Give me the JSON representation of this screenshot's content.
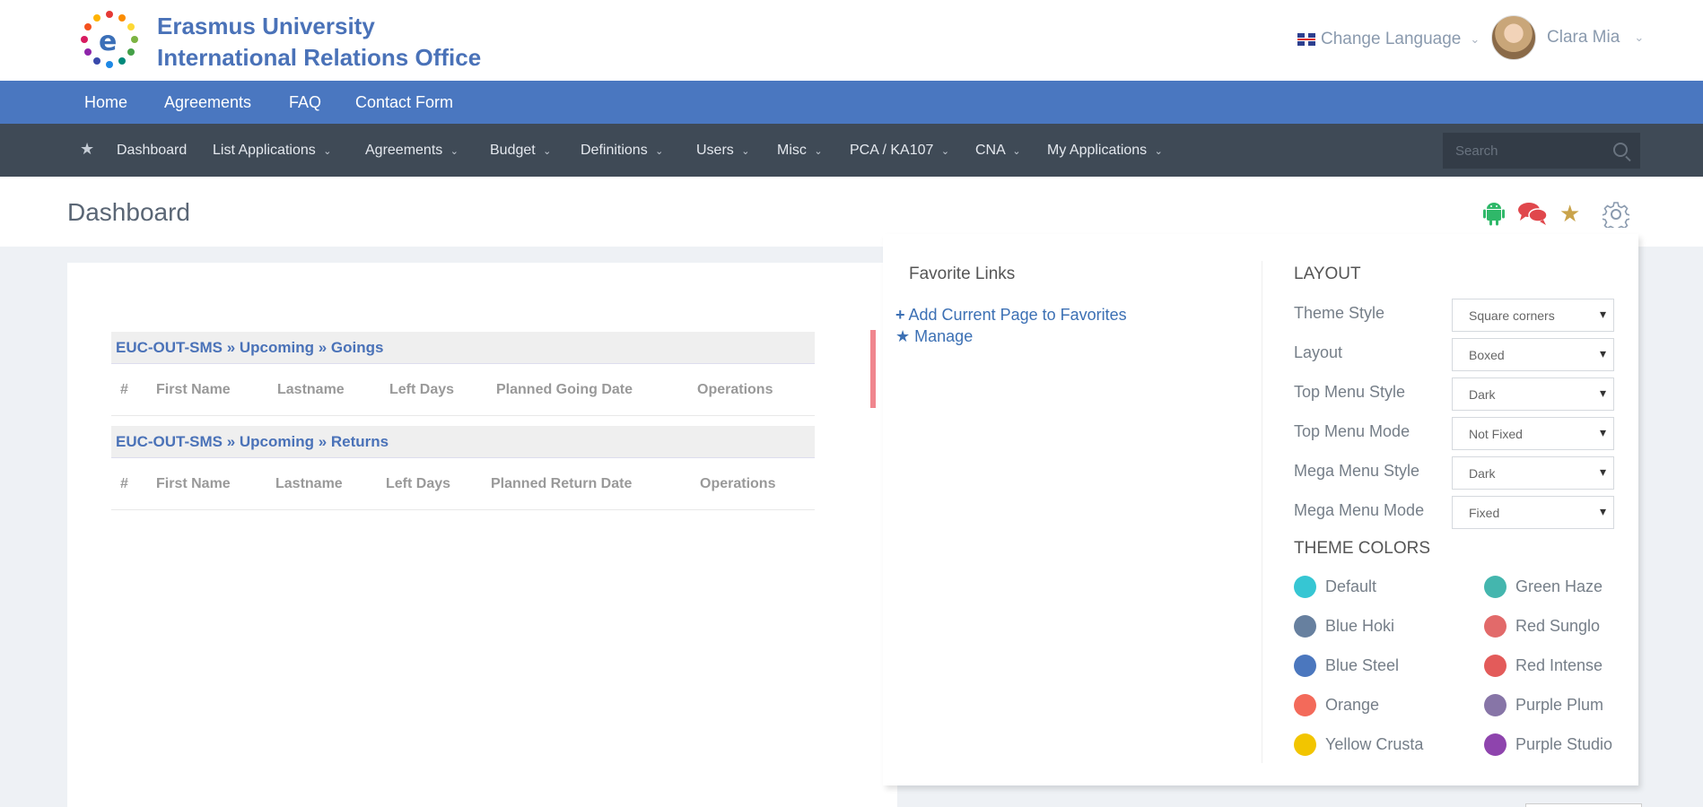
{
  "header": {
    "org_line1": "Erasmus University",
    "org_line2": "International Relations Office",
    "language_label": "Change Language",
    "user_name": "Clara Mia"
  },
  "top_nav": [
    "Home",
    "Agreements",
    "FAQ",
    "Contact Form"
  ],
  "mega_menu": {
    "items": [
      {
        "label": "Dashboard",
        "has_dropdown": false
      },
      {
        "label": "List Applications",
        "has_dropdown": true
      },
      {
        "label": "Agreements",
        "has_dropdown": true
      },
      {
        "label": "Budget",
        "has_dropdown": true
      },
      {
        "label": "Definitions",
        "has_dropdown": true
      },
      {
        "label": "Users",
        "has_dropdown": true
      },
      {
        "label": "Misc",
        "has_dropdown": true
      },
      {
        "label": "PCA / KA107",
        "has_dropdown": true
      },
      {
        "label": "CNA",
        "has_dropdown": true
      },
      {
        "label": "My Applications",
        "has_dropdown": true
      }
    ],
    "search_placeholder": "Search"
  },
  "page": {
    "title": "Dashboard"
  },
  "tables": [
    {
      "caption": "EUC-OUT-SMS » Upcoming » Goings",
      "columns": [
        "#",
        "First Name",
        "Lastname",
        "Left Days",
        "Planned Going Date",
        "Operations"
      ]
    },
    {
      "caption": "EUC-OUT-SMS » Upcoming » Returns",
      "columns": [
        "#",
        "First Name",
        "Lastname",
        "Left Days",
        "Planned Return Date",
        "Operations"
      ]
    }
  ],
  "panel": {
    "favorites_title": "Favorite Links",
    "add_favorite": "Add Current Page to Favorites",
    "manage": "Manage",
    "layout_title": "LAYOUT",
    "layout_options": [
      {
        "label": "Theme Style",
        "value": "Square corners"
      },
      {
        "label": "Layout",
        "value": "Boxed"
      },
      {
        "label": "Top Menu Style",
        "value": "Dark"
      },
      {
        "label": "Top Menu Mode",
        "value": "Not Fixed"
      },
      {
        "label": "Mega Menu Style",
        "value": "Dark"
      },
      {
        "label": "Mega Menu Mode",
        "value": "Fixed"
      }
    ],
    "colors_title": "THEME COLORS",
    "theme_colors": [
      {
        "name": "Default",
        "color": "#36c6d3"
      },
      {
        "name": "Green Haze",
        "color": "#44b6ae"
      },
      {
        "name": "Blue Hoki",
        "color": "#67809f"
      },
      {
        "name": "Red Sunglo",
        "color": "#e26a6a"
      },
      {
        "name": "Blue Steel",
        "color": "#4b77be"
      },
      {
        "name": "Red Intense",
        "color": "#e35b5a"
      },
      {
        "name": "Orange",
        "color": "#f36a5a"
      },
      {
        "name": "Purple Plum",
        "color": "#8775a7"
      },
      {
        "name": "Yellow Crusta",
        "color": "#f2c500"
      },
      {
        "name": "Purple Studio",
        "color": "#8e44ad"
      }
    ]
  },
  "colors": {
    "brand": "#4a72b8",
    "nav_blue": "#4a77c0",
    "nav_dark": "#3f4a56"
  }
}
